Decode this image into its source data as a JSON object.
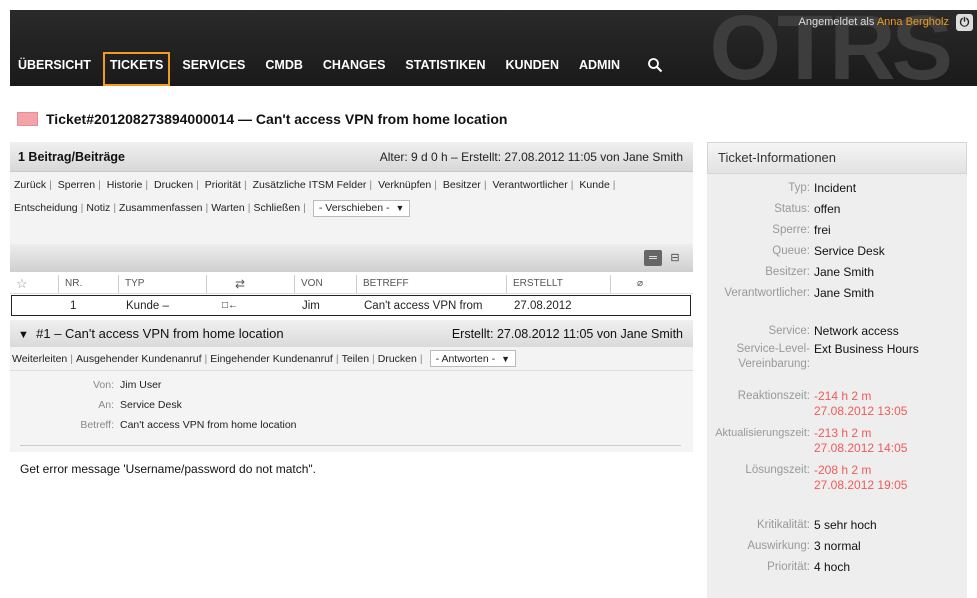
{
  "header": {
    "logo": "OTRS",
    "login_prefix": "Angemeldet als",
    "login_user": "Anna Bergholz",
    "nav": [
      "ÜBERSICHT",
      "TICKETS",
      "SERVICES",
      "CMDB",
      "CHANGES",
      "STATISTIKEN",
      "KUNDEN",
      "ADMIN"
    ],
    "active_nav": "TICKETS",
    "search_icon": "search-icon",
    "logout_icon": "power-icon"
  },
  "ticket": {
    "title": "Ticket#201208273894000014 — Can't access VPN from home location",
    "priority_color": "#f4a3a8"
  },
  "articles_bar": {
    "count": "1 Beitrag/Beiträge",
    "age": "Alter: 9 d 0 h – Erstellt: 27.08.2012 11:05 von Jane Smith"
  },
  "menu": {
    "row1": [
      "Zurück",
      "Sperren",
      "Historie",
      "Drucken",
      "Priorität",
      "Zusätzliche ITSM Felder",
      "Verknüpfen",
      "Besitzer",
      "Verantwortlicher",
      "Kunde"
    ],
    "row2": [
      "Entscheidung",
      "Notiz",
      "Zusammenfassen",
      "Warten",
      "Schließen"
    ],
    "move_select": "- Verschieben -"
  },
  "table": {
    "columns": [
      "NR.",
      "TYP",
      "⇄",
      "VON",
      "BETREFF",
      "ERSTELLT"
    ],
    "row": {
      "nr": "1",
      "typ": "Kunde –",
      "dir": "□←",
      "von": "Jim",
      "betreff": "Can't access VPN from",
      "erstellt": "27.08.2012"
    }
  },
  "article": {
    "title": "#1 – Can't access VPN from home location",
    "created": "Erstellt: 27.08.2012 11:05 von Jane Smith",
    "menu": [
      "Weiterleiten",
      "Ausgehender Kundenanruf",
      "Eingehender Kundenanruf",
      "Teilen",
      "Drucken"
    ],
    "reply_select": "- Antworten -",
    "headers": [
      {
        "label": "Von:",
        "value": "Jim User"
      },
      {
        "label": "An:",
        "value": "Service Desk"
      },
      {
        "label": "Betreff:",
        "value": "Can't access VPN from home location"
      }
    ],
    "body": "Get error message 'Username/password do not match\"."
  },
  "info": {
    "title": "Ticket-Informationen",
    "typ_label": "Typ:",
    "typ": "Incident",
    "status_label": "Status:",
    "status": "offen",
    "sperre_label": "Sperre:",
    "sperre": "frei",
    "queue_label": "Queue:",
    "queue": "Service Desk",
    "besitzer_label": "Besitzer:",
    "besitzer": "Jane Smith",
    "verantwortlich_label": "Verantwortlicher:",
    "verantwortlich": "Jane Smith",
    "service_label": "Service:",
    "service": "Network access",
    "sla_label1": "Service-Level-",
    "sla_label2": "Vereinbarung:",
    "sla": "Ext Business Hours",
    "reaktion_label": "Reaktionszeit:",
    "reaktion1": "-214 h 2 m",
    "reaktion2": "27.08.2012 13:05",
    "aktual_label": "Aktualisierungszeit:",
    "aktual1": "-213 h 2 m",
    "aktual2": "27.08.2012 14:05",
    "loesung_label": "Lösungszeit:",
    "loesung1": "-208 h 2 m",
    "loesung2": "27.08.2012 19:05",
    "krit_label": "Kritikalität:",
    "krit": "5 sehr hoch",
    "ausw_label": "Auswirkung:",
    "ausw": "3 normal",
    "prio_label": "Priorität:",
    "prio": "4 hoch",
    "red_color": "#f15a5a"
  }
}
